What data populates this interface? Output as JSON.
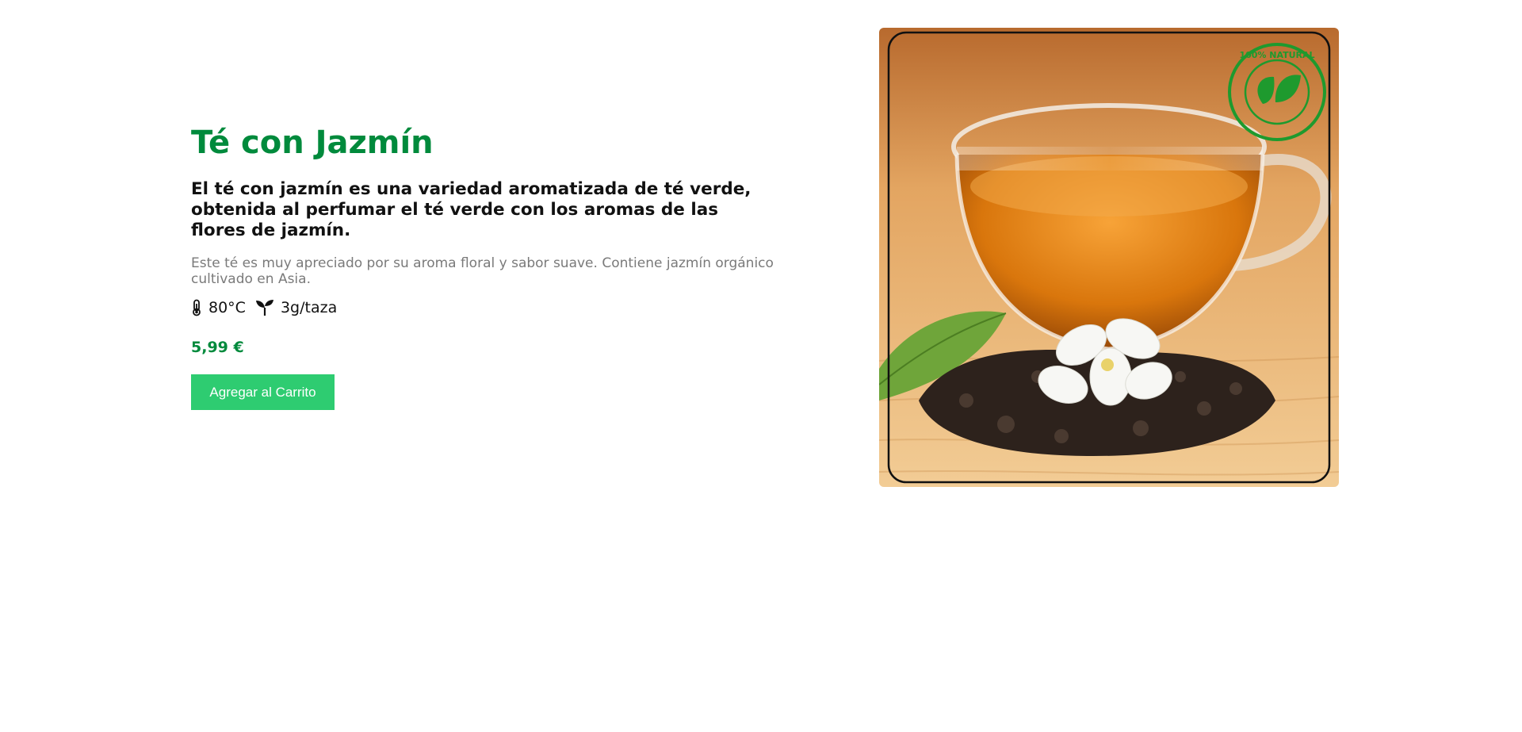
{
  "product": {
    "title": "Té con Jazmín",
    "lead": "El té con jazmín es una variedad aromatizada de té verde, obtenida al perfumar el té verde con los aromas de las flores de jazmín.",
    "description": "Este té es muy apreciado por su aroma floral y sabor suave. Contiene jazmín orgánico cultivado en Asia.",
    "specs": {
      "temperature": "80°C",
      "temperature_icon": "thermometer-icon",
      "dose": "3g/taza",
      "dose_icon": "sprout-icon"
    },
    "price": "5,99 €",
    "add_to_cart_label": "Agregar al Carrito"
  },
  "image": {
    "badge_text": "100% NATURAL",
    "colors": {
      "accent_green": "#008a3c",
      "button_green": "#2ecc71",
      "badge_green": "#1e9a2e",
      "tea_amber": "#d9760c"
    }
  }
}
